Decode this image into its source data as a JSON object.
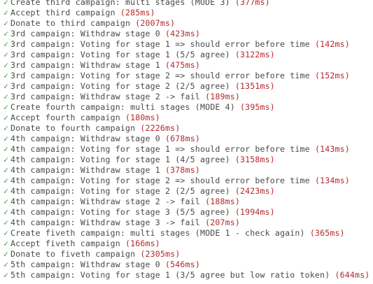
{
  "colors": {
    "check": "#3f9b3f",
    "text": "#4a4a4a",
    "duration": "#b5292c",
    "background": "#ffffff"
  },
  "check_icon": "check-icon",
  "tests": [
    {
      "check": "✓",
      "text": "Create third campaign: multi stages (MODE 3)",
      "duration": "(377ms)"
    },
    {
      "check": "✓",
      "text": "Accept third campaign",
      "duration": "(285ms)"
    },
    {
      "check": "✓",
      "text": "Donate to third campaign",
      "duration": "(2007ms)"
    },
    {
      "check": "✓",
      "text": "3rd campaign: Withdraw stage 0",
      "duration": "(423ms)"
    },
    {
      "check": "✓",
      "text": "3rd campaign: Voting for stage 1 => should error before time",
      "duration": "(142ms)"
    },
    {
      "check": "✓",
      "text": "3rd campaign: Voting for stage 1 (5/5 agree)",
      "duration": "(3122ms)"
    },
    {
      "check": "✓",
      "text": "3rd campaign: Withdraw stage 1",
      "duration": "(475ms)"
    },
    {
      "check": "✓",
      "text": "3rd campaign: Voting for stage 2 => should error before time",
      "duration": "(152ms)"
    },
    {
      "check": "✓",
      "text": "3rd campaign: Voting for stage 2 (2/5 agree)",
      "duration": "(1351ms)"
    },
    {
      "check": "✓",
      "text": "3rd campaign: Withdraw stage 2 -> fail",
      "duration": "(189ms)"
    },
    {
      "check": "✓",
      "text": "Create fourth campaign: multi stages (MODE 4)",
      "duration": "(395ms)"
    },
    {
      "check": "✓",
      "text": "Accept fourth campaign",
      "duration": "(180ms)"
    },
    {
      "check": "✓",
      "text": "Donate to fourth campaign",
      "duration": "(2226ms)"
    },
    {
      "check": "✓",
      "text": "4th campaign: Withdraw stage 0",
      "duration": "(678ms)"
    },
    {
      "check": "✓",
      "text": "4th campaign: Voting for stage 1 => should error before time",
      "duration": "(143ms)"
    },
    {
      "check": "✓",
      "text": "4th campaign: Voting for stage 1 (4/5 agree)",
      "duration": "(3158ms)"
    },
    {
      "check": "✓",
      "text": "4th campaign: Withdraw stage 1",
      "duration": "(378ms)"
    },
    {
      "check": "✓",
      "text": "4th campaign: Voting for stage 2 => should error before time",
      "duration": "(134ms)"
    },
    {
      "check": "✓",
      "text": "4th campaign: Voting for stage 2 (2/5 agree)",
      "duration": "(2423ms)"
    },
    {
      "check": "✓",
      "text": "4th campaign: Withdraw stage 2 -> fail",
      "duration": "(188ms)"
    },
    {
      "check": "✓",
      "text": "4th campaign: Voting for stage 3 (5/5 agree)",
      "duration": "(1994ms)"
    },
    {
      "check": "✓",
      "text": "4th campaign: Withdraw stage 3 -> fail",
      "duration": "(207ms)"
    },
    {
      "check": "✓",
      "text": "Create fiveth campaign: multi stages (MODE 1 - check again)",
      "duration": "(365ms)"
    },
    {
      "check": "✓",
      "text": "Accept fiveth campaign",
      "duration": "(166ms)"
    },
    {
      "check": "✓",
      "text": "Donate to fiveth campaign",
      "duration": "(2305ms)"
    },
    {
      "check": "✓",
      "text": "5th campaign: Withdraw stage 0",
      "duration": "(546ms)"
    },
    {
      "check": "✓",
      "text": "5th campaign: Voting for stage 1 (3/5 agree but low ratio token)",
      "duration": "(644ms)"
    }
  ]
}
